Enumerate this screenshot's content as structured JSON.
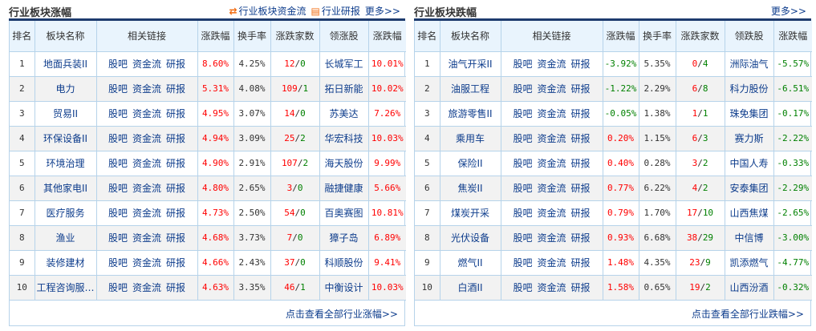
{
  "colors": {
    "up": "#ff0000",
    "down": "#008000",
    "link": "#0d3c8c",
    "header_bg": "#e9f4fd",
    "border": "#b6d3ea"
  },
  "left": {
    "title": "行业板块涨幅",
    "tool_fundflow": "行业板块资金流",
    "tool_research": "行业研报",
    "more": "更多>>",
    "headers": [
      "排名",
      "板块名称",
      "相关链接",
      "涨跌幅",
      "换手率",
      "涨跌家数",
      "领涨股",
      "涨跌幅"
    ],
    "links": [
      "股吧",
      "资金流",
      "研报"
    ],
    "rows": [
      {
        "rank": "1",
        "name": "地面兵装II",
        "chg": "8.60%",
        "turn": "4.25%",
        "up": "12",
        "down": "0",
        "lead": "长城军工",
        "lchg": "10.01%"
      },
      {
        "rank": "2",
        "name": "电力",
        "chg": "5.31%",
        "turn": "4.08%",
        "up": "109",
        "down": "1",
        "lead": "拓日新能",
        "lchg": "10.02%"
      },
      {
        "rank": "3",
        "name": "贸易II",
        "chg": "4.95%",
        "turn": "3.07%",
        "up": "14",
        "down": "0",
        "lead": "苏美达",
        "lchg": "7.26%"
      },
      {
        "rank": "4",
        "name": "环保设备II",
        "chg": "4.94%",
        "turn": "3.09%",
        "up": "25",
        "down": "2",
        "lead": "华宏科技",
        "lchg": "10.03%"
      },
      {
        "rank": "5",
        "name": "环境治理",
        "chg": "4.90%",
        "turn": "2.91%",
        "up": "107",
        "down": "2",
        "lead": "海天股份",
        "lchg": "9.99%"
      },
      {
        "rank": "6",
        "name": "其他家电II",
        "chg": "4.80%",
        "turn": "2.65%",
        "up": "3",
        "down": "0",
        "lead": "融捷健康",
        "lchg": "5.66%"
      },
      {
        "rank": "7",
        "name": "医疗服务",
        "chg": "4.73%",
        "turn": "2.50%",
        "up": "54",
        "down": "0",
        "lead": "百奥赛图",
        "lchg": "10.81%"
      },
      {
        "rank": "8",
        "name": "渔业",
        "chg": "4.68%",
        "turn": "3.73%",
        "up": "7",
        "down": "0",
        "lead": "獐子岛",
        "lchg": "6.89%"
      },
      {
        "rank": "9",
        "name": "装修建材",
        "chg": "4.66%",
        "turn": "2.43%",
        "up": "37",
        "down": "0",
        "lead": "科顺股份",
        "lchg": "9.41%"
      },
      {
        "rank": "10",
        "name": "工程咨询服…",
        "chg": "4.63%",
        "turn": "3.35%",
        "up": "46",
        "down": "1",
        "lead": "中衡设计",
        "lchg": "10.03%"
      }
    ],
    "footer": "点击查看全部行业涨幅>>"
  },
  "right": {
    "title": "行业板块跌幅",
    "more": "更多>>",
    "headers": [
      "排名",
      "板块名称",
      "相关链接",
      "涨跌幅",
      "换手率",
      "涨跌家数",
      "领跌股",
      "涨跌幅"
    ],
    "links": [
      "股吧",
      "资金流",
      "研报"
    ],
    "rows": [
      {
        "rank": "1",
        "name": "油气开采II",
        "chg": "-3.92%",
        "turn": "5.35%",
        "up": "0",
        "down": "4",
        "lead": "洲际油气",
        "lchg": "-5.57%"
      },
      {
        "rank": "2",
        "name": "油服工程",
        "chg": "-1.22%",
        "turn": "2.29%",
        "up": "6",
        "down": "8",
        "lead": "科力股份",
        "lchg": "-6.51%"
      },
      {
        "rank": "3",
        "name": "旅游零售II",
        "chg": "-0.05%",
        "turn": "1.38%",
        "up": "1",
        "down": "1",
        "lead": "珠免集团",
        "lchg": "-0.17%"
      },
      {
        "rank": "4",
        "name": "乘用车",
        "chg": "0.20%",
        "turn": "1.15%",
        "up": "6",
        "down": "3",
        "lead": "赛力斯",
        "lchg": "-2.22%"
      },
      {
        "rank": "5",
        "name": "保险II",
        "chg": "0.40%",
        "turn": "0.28%",
        "up": "3",
        "down": "2",
        "lead": "中国人寿",
        "lchg": "-0.33%"
      },
      {
        "rank": "6",
        "name": "焦炭II",
        "chg": "0.77%",
        "turn": "6.22%",
        "up": "4",
        "down": "2",
        "lead": "安泰集团",
        "lchg": "-2.29%"
      },
      {
        "rank": "7",
        "name": "煤炭开采",
        "chg": "0.79%",
        "turn": "1.70%",
        "up": "17",
        "down": "10",
        "lead": "山西焦煤",
        "lchg": "-2.65%"
      },
      {
        "rank": "8",
        "name": "光伏设备",
        "chg": "0.93%",
        "turn": "6.68%",
        "up": "38",
        "down": "29",
        "lead": "中信博",
        "lchg": "-3.00%"
      },
      {
        "rank": "9",
        "name": "燃气II",
        "chg": "1.48%",
        "turn": "4.35%",
        "up": "23",
        "down": "9",
        "lead": "凯添燃气",
        "lchg": "-4.77%"
      },
      {
        "rank": "10",
        "name": "白酒II",
        "chg": "1.58%",
        "turn": "0.65%",
        "up": "19",
        "down": "2",
        "lead": "山西汾酒",
        "lchg": "-0.32%"
      }
    ],
    "footer": "点击查看全部行业跌幅>>"
  }
}
